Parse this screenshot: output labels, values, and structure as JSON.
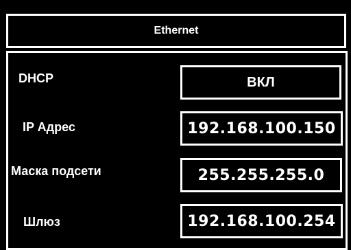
{
  "header": {
    "title": "Ethernet"
  },
  "settings": {
    "dhcp": {
      "label": "DHCP",
      "value": "ВКЛ"
    },
    "ip": {
      "label": "IP Адрес",
      "value": "192.168.100.150"
    },
    "mask": {
      "label": "Маска подсети",
      "value": "255.255.255.0"
    },
    "gateway": {
      "label": "Шлюз",
      "value": "192.168.100.254"
    }
  }
}
